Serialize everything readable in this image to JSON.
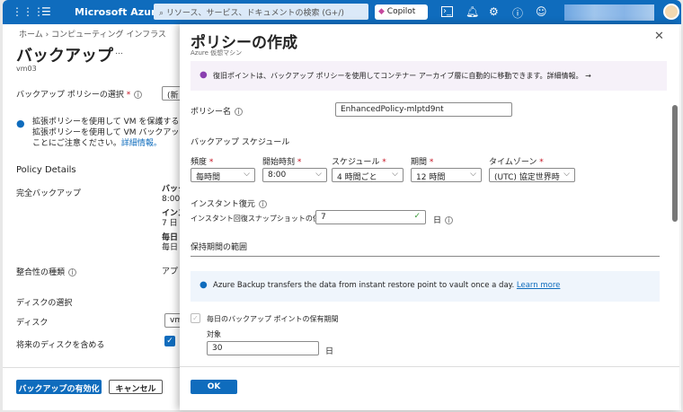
{
  "header": {
    "brand": "Microsoft Azure",
    "search_placeholder": "リソース、サービス、ドキュメントの検索 (G+/)",
    "copilot": "Copilot"
  },
  "left": {
    "breadcrumb": "ホーム  ›  コンピューティング インフラス",
    "title": "バックアップ",
    "more": "…",
    "subtitle": "vm03",
    "policy_label": "バックアップ ポリシーの選択",
    "policy_value": "(新",
    "info_line1": "拡張ポリシーを使用して VM を保護すると、スナッ",
    "info_line2": "拡張ポリシーを使用して VM バックアップを有効に",
    "info_line3": "ことにご注意ください。",
    "info_link": "詳細情報。",
    "policy_details": "Policy Details",
    "full_backup": "完全バックアップ",
    "full_vals": [
      "バック",
      "8:00",
      "インス",
      "7 日",
      "毎日",
      "毎日"
    ],
    "consistency": "整合性の種類",
    "consistency_value": "アプリ",
    "disk_section": "ディスクの選択",
    "disk_label": "ディスク",
    "disk_value": "vm",
    "future_disks": "将来のディスクを含める",
    "enable_button": "バックアップの有効化",
    "cancel_button": "キャンセル"
  },
  "flyout": {
    "title": "ポリシーの作成",
    "subtitle": "Azure 仮想マシン",
    "banner": "復旧ポイントは、バックアップ ポリシーを使用してコンテナー アーカイブ層に自動的に移動できます。詳細情報。 →",
    "policy_name_label": "ポリシー名",
    "policy_name_value": "EnhancedPolicy-mlptd9nt",
    "schedule_section": "バックアップ スケジュール",
    "fields": [
      {
        "label": "頻度",
        "value": "毎時間"
      },
      {
        "label": "開始時刻",
        "value": "8:00"
      },
      {
        "label": "スケジュール",
        "value": "4 時間ごと"
      },
      {
        "label": "期間",
        "value": "12 時間"
      },
      {
        "label": "タイムゾーン",
        "value": "(UTC) 協定世界時"
      }
    ],
    "instant_restore": "インスタント復元",
    "snapshot_label": "インスタント回復スナップショットの保有期間",
    "snapshot_value": "7",
    "snapshot_unit": "日",
    "retention_section": "保持期間の範囲",
    "info_text": "Azure Backup transfers the data from instant restore point to vault once a day.",
    "info_link": "Learn more",
    "daily_label": "毎日のバックアップ ポイントの保有期間",
    "target_label": "対象",
    "target_value": "30",
    "target_unit": "日",
    "ok_button": "OK"
  },
  "colors": {
    "brand": "#0f6cbd",
    "banner_bg": "#f6f1f9",
    "info_bg": "#eff5fc"
  }
}
